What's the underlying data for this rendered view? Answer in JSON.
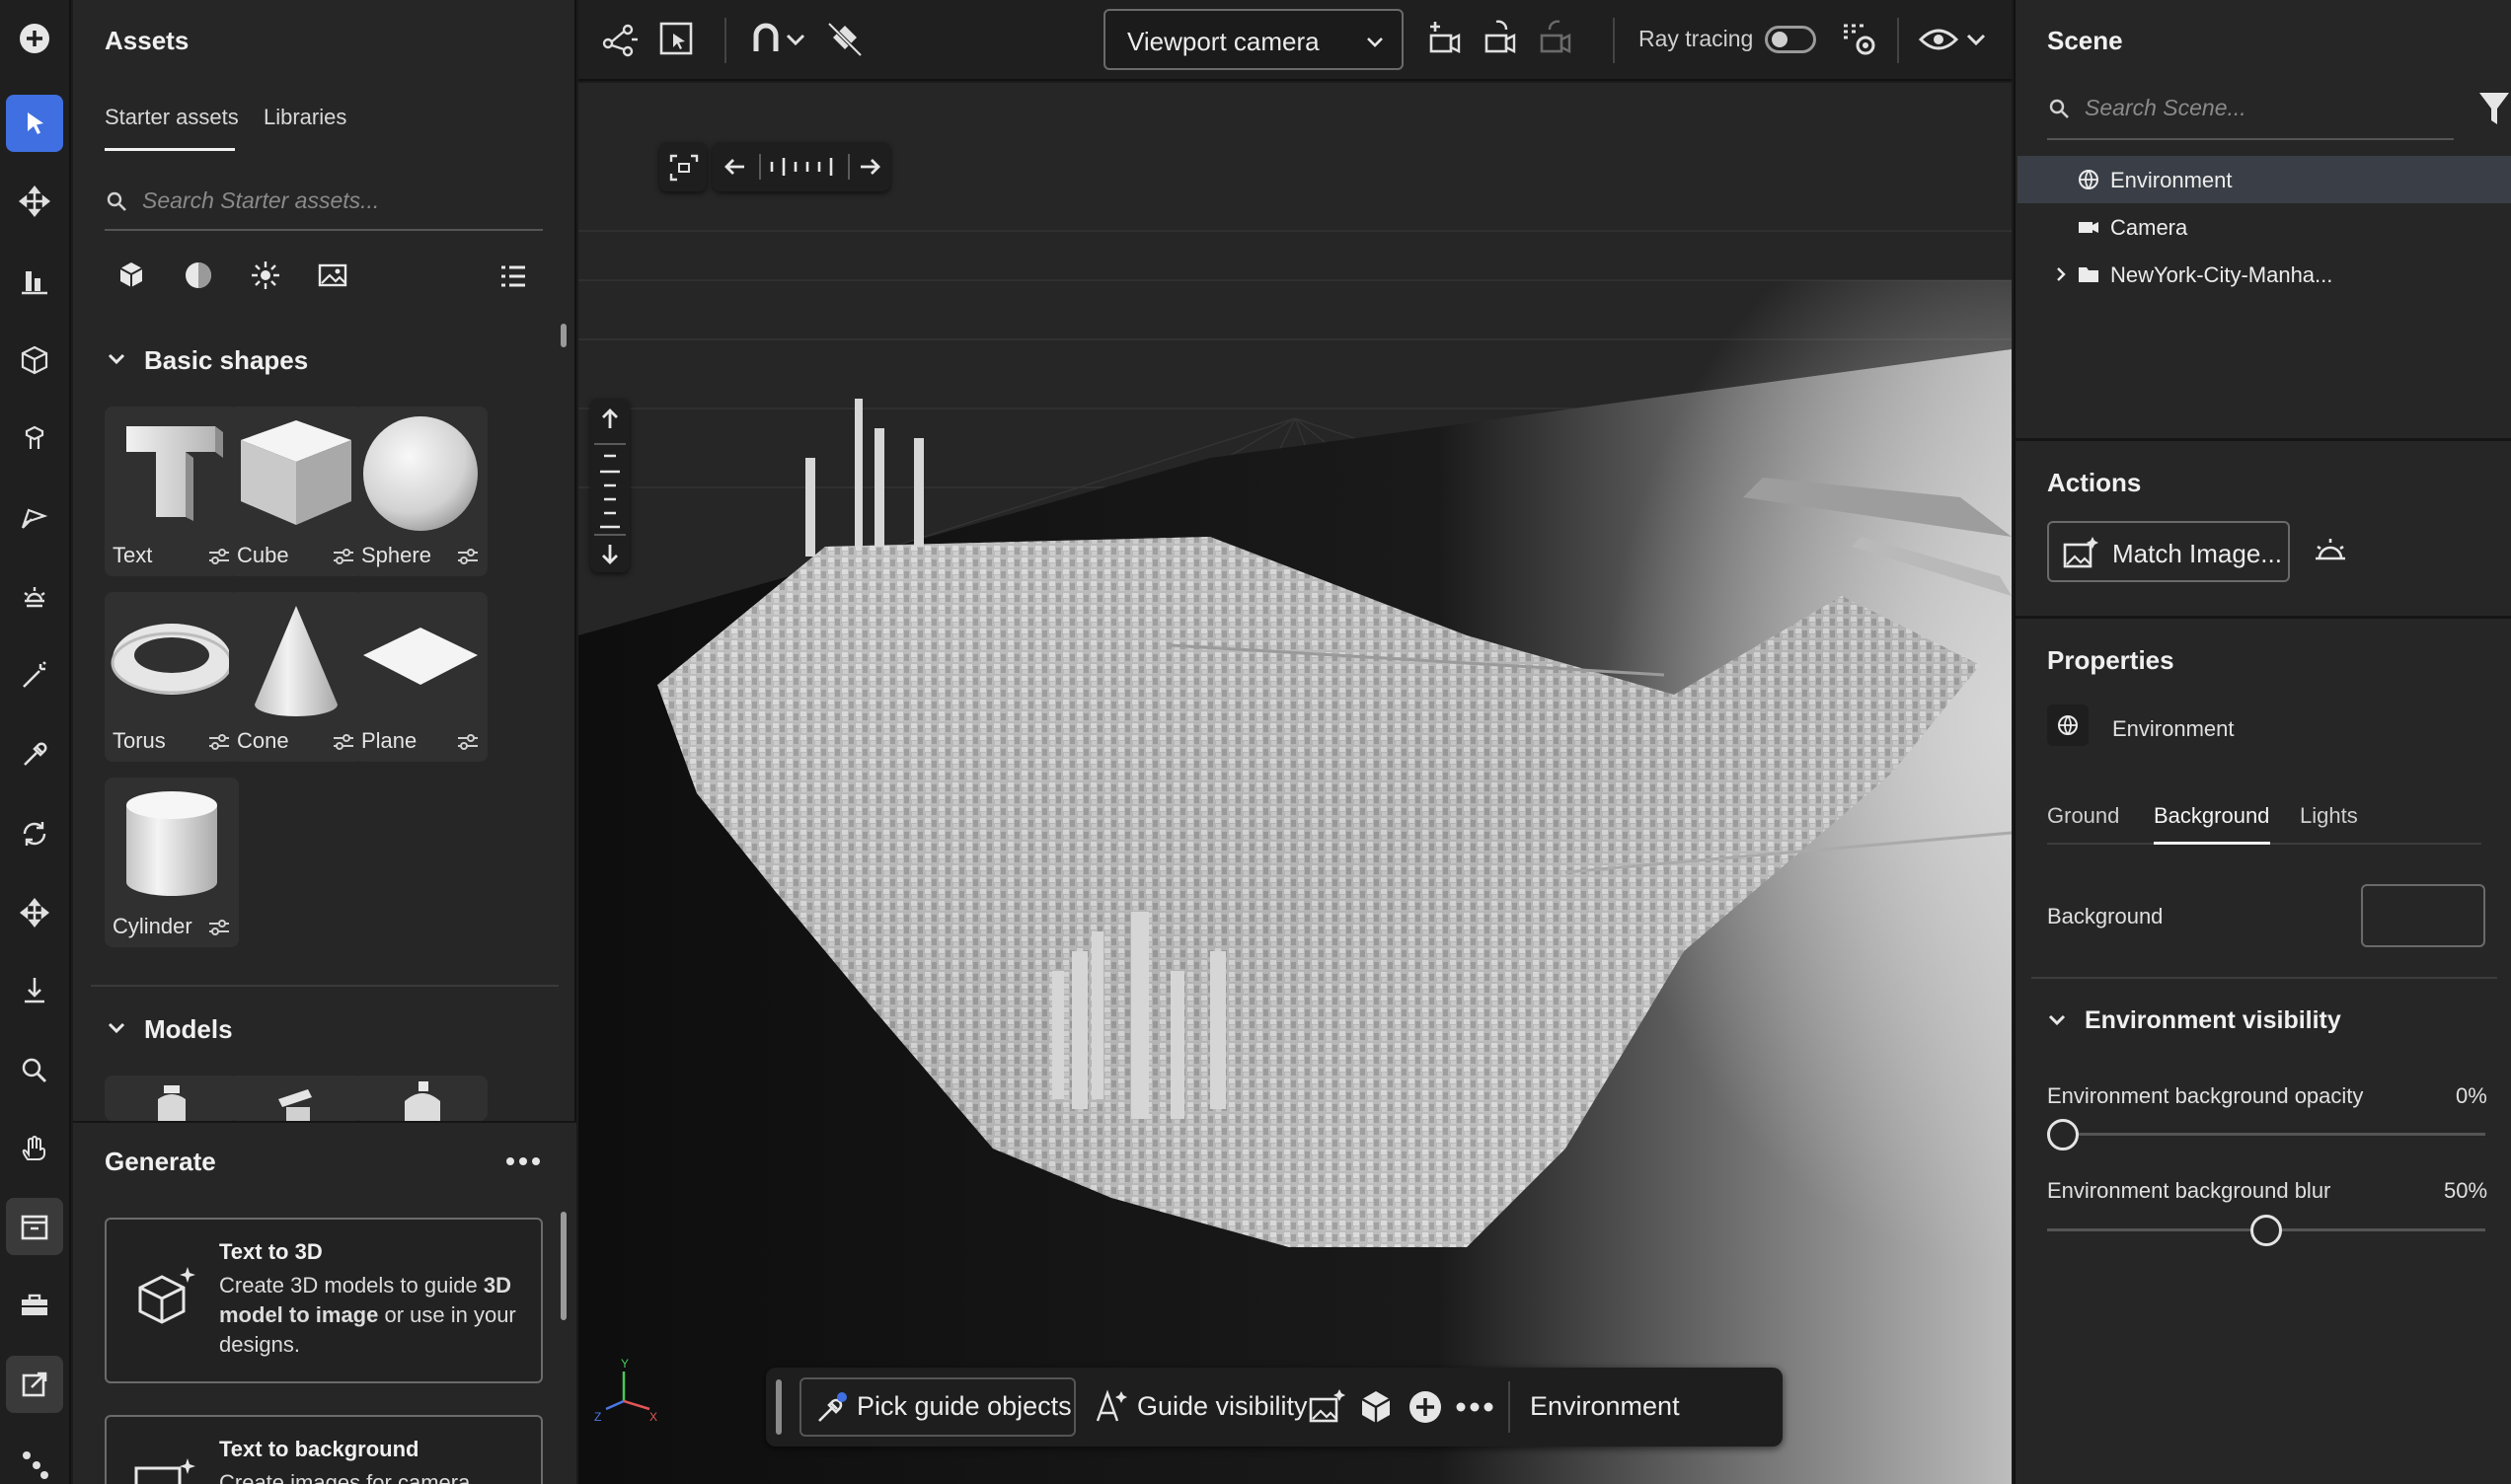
{
  "assets_panel": {
    "title": "Assets",
    "tabs": [
      "Starter assets",
      "Libraries"
    ],
    "search_placeholder": "Search Starter assets...",
    "basic_shapes_header": "Basic shapes",
    "shapes": [
      "Text",
      "Cube",
      "Sphere",
      "Torus",
      "Cone",
      "Plane",
      "Cylinder"
    ],
    "models_header": "Models"
  },
  "generate": {
    "title": "Generate",
    "cards": [
      {
        "title": "Text to 3D",
        "desc_parts": [
          "Create 3D models to guide ",
          "3D model to image",
          " or use in your designs."
        ]
      },
      {
        "title": "Text to background",
        "desc": "Create images for camera"
      }
    ]
  },
  "toolbar": {
    "camera_select": "Viewport camera",
    "ray_tracing_label": "Ray tracing",
    "ray_tracing_on": false
  },
  "bottom_bar": {
    "pick_guide": "Pick guide objects",
    "guide_visibility": "Guide visibility",
    "environment": "Environment"
  },
  "axes": {
    "x": "X",
    "y": "Y",
    "z": "Z"
  },
  "scene_panel": {
    "title": "Scene",
    "search_placeholder": "Search Scene...",
    "tree": [
      {
        "label": "Environment",
        "icon": "globe-icon",
        "selected": true
      },
      {
        "label": "Camera",
        "icon": "video-camera-icon",
        "selected": false
      },
      {
        "label": "NewYork-City-Manha...",
        "icon": "folder-icon",
        "selected": false,
        "expandable": true
      }
    ]
  },
  "actions": {
    "title": "Actions",
    "match_image": "Match Image..."
  },
  "properties": {
    "title": "Properties",
    "object_name": "Environment",
    "tabs": [
      "Ground",
      "Background",
      "Lights"
    ],
    "active_tab": "Background",
    "background_label": "Background",
    "background_color": "#262626",
    "visibility_header": "Environment visibility",
    "opacity_label": "Environment background opacity",
    "opacity_value": "0%",
    "opacity_fraction": 0,
    "blur_label": "Environment background blur",
    "blur_value": "50%",
    "blur_fraction": 0.5
  },
  "colors": {
    "accent": "#3f6fe0",
    "panel": "#262626",
    "toolbar": "#1f1f1f"
  }
}
